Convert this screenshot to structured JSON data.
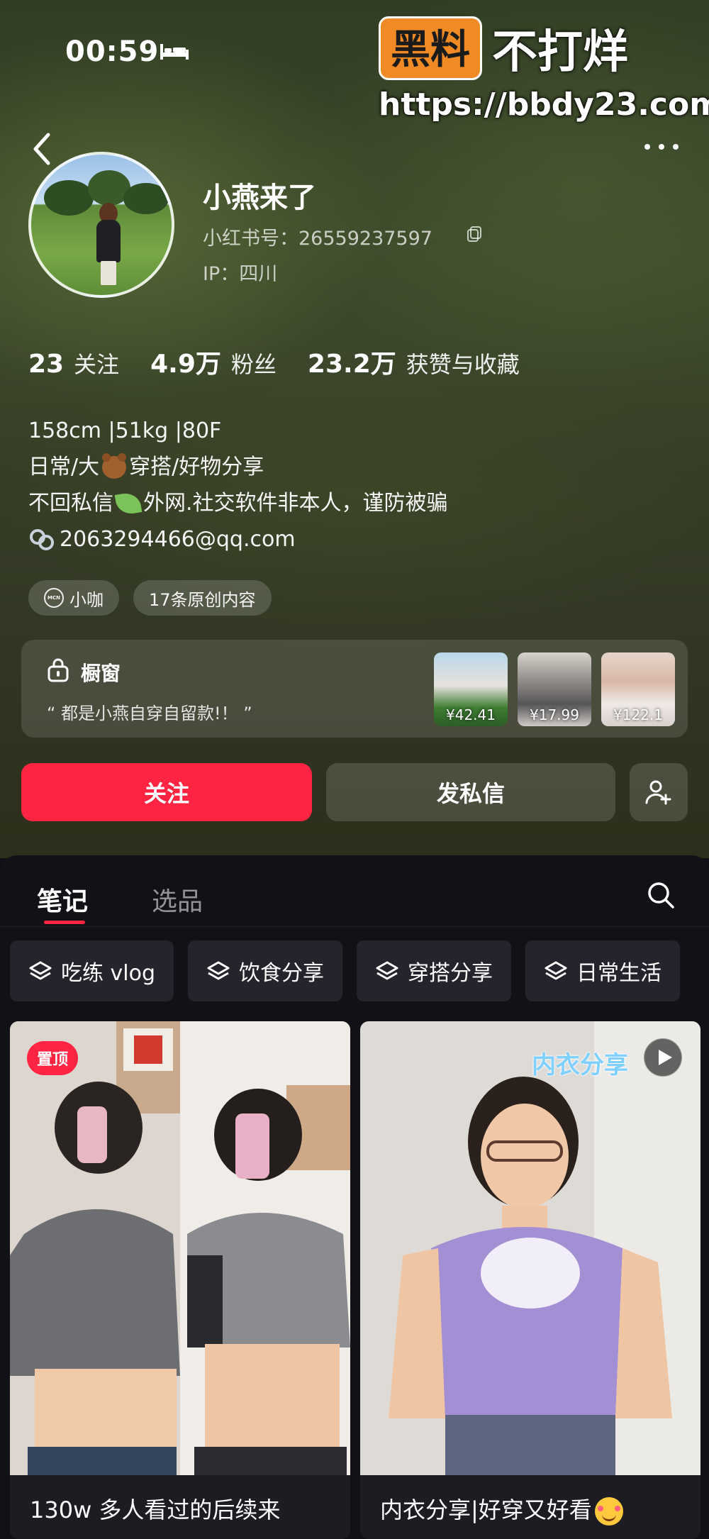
{
  "status_bar": {
    "time": "00:59"
  },
  "watermark": {
    "badge": "黑料",
    "text": "不打烊",
    "url": "https://bbdy23.com"
  },
  "profile": {
    "name": "小燕来了",
    "red_id": "小红书号：26559237597",
    "ip": "IP：四川",
    "stats": [
      {
        "num": "23",
        "label": "关注"
      },
      {
        "num": "4.9万",
        "label": "粉丝"
      },
      {
        "num": "23.2万",
        "label": "获赞与收藏"
      }
    ],
    "bio": {
      "line1": "158cm |51kg |80F",
      "line2_a": "日常/大",
      "line2_b": "穿搭/好物分享",
      "line3_a": "不回私信",
      "line3_b": "外网.社交软件非本人，谨防被骗",
      "email": "2063294466@qq.com"
    },
    "tags": {
      "mcn_icon": "MCN",
      "mcn": "小咖",
      "original": "17条原创内容"
    }
  },
  "shop": {
    "title": "橱窗",
    "quote": "“ 都是小燕自穿自留款!！ ”",
    "products": [
      {
        "price": "¥42.41"
      },
      {
        "price": "¥17.99"
      },
      {
        "price": "¥122.1"
      }
    ]
  },
  "actions": {
    "follow": "关注",
    "message": "发私信"
  },
  "tabs": {
    "notes": "笔记",
    "select": "选品"
  },
  "chips": [
    "吃练 vlog",
    "饮食分享",
    "穿搭分享",
    "日常生活"
  ],
  "cards": [
    {
      "badge": "置顶",
      "caption": "130w 多人看过的后续来"
    },
    {
      "overlay": "内衣分享",
      "caption": "内衣分享|好穿又好看"
    }
  ],
  "icons": {
    "back": "back-chevron-icon",
    "more": "more-dots-icon",
    "copy": "copy-icon",
    "shop": "shop-bag-icon",
    "add_user": "add-user-icon",
    "search": "search-icon",
    "chip": "layers-icon",
    "video": "play-icon",
    "link": "link-icon"
  },
  "colors": {
    "accent": "#ff2442",
    "background": "#111116"
  }
}
